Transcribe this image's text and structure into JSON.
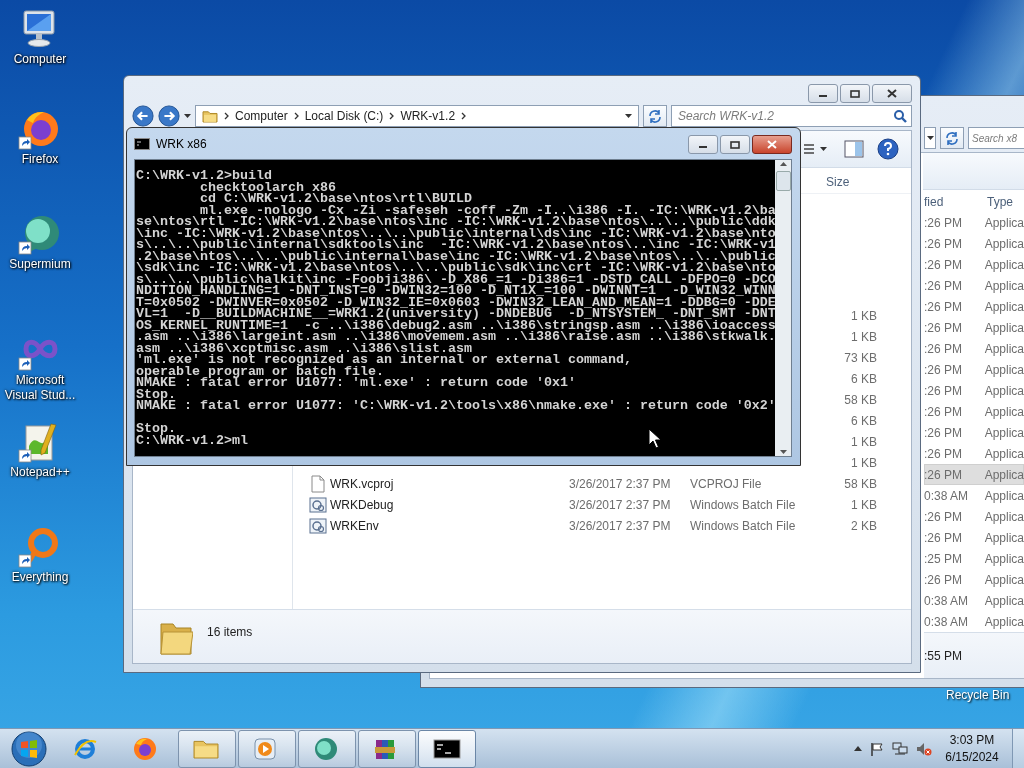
{
  "desktop": {
    "icons": [
      {
        "label": "Computer"
      },
      {
        "label": "Firefox"
      },
      {
        "label": "Supermium"
      },
      {
        "label": "Microsoft Visual Stud..."
      },
      {
        "label": "Notepad++"
      },
      {
        "label": "Everything"
      }
    ],
    "recycle_bin_label": "Recycle Bin"
  },
  "back_explorer": {
    "search": {
      "placeholder": "Search x8"
    },
    "columns": [
      "fied",
      "Type"
    ],
    "rows": [
      {
        "date": ":26 PM",
        "type": "Applica",
        "selected": false
      },
      {
        "date": ":26 PM",
        "type": "Applica",
        "selected": false
      },
      {
        "date": ":26 PM",
        "type": "Applica",
        "selected": false
      },
      {
        "date": ":26 PM",
        "type": "Applica",
        "selected": false
      },
      {
        "date": ":26 PM",
        "type": "Applica",
        "selected": false
      },
      {
        "date": ":26 PM",
        "type": "Applica",
        "selected": false
      },
      {
        "date": ":26 PM",
        "type": "Applica",
        "selected": false
      },
      {
        "date": ":26 PM",
        "type": "Applica",
        "selected": false
      },
      {
        "date": ":26 PM",
        "type": "Applica",
        "selected": false
      },
      {
        "date": ":26 PM",
        "type": "Applica",
        "selected": false
      },
      {
        "date": ":26 PM",
        "type": "Applica",
        "selected": false
      },
      {
        "date": ":26 PM",
        "type": "Applica",
        "selected": false
      },
      {
        "date": ":26 PM",
        "type": "Applica",
        "selected": true
      },
      {
        "date": "0:38 AM",
        "type": "Applica",
        "selected": false
      },
      {
        "date": ":26 PM",
        "type": "Applica",
        "selected": false
      },
      {
        "date": ":26 PM",
        "type": "Applica",
        "selected": false
      },
      {
        "date": ":25 PM",
        "type": "Applica",
        "selected": false
      },
      {
        "date": ":26 PM",
        "type": "Applica",
        "selected": false
      },
      {
        "date": "0:38 AM",
        "type": "Applica",
        "selected": false
      },
      {
        "date": "0:38 AM",
        "type": "Applica",
        "selected": false
      }
    ],
    "status": ":55 PM"
  },
  "explorer": {
    "address": {
      "crumbs": [
        "Computer",
        "Local Disk (C:)",
        "WRK-v1.2"
      ]
    },
    "search": {
      "placeholder": "Search WRK-v1.2"
    },
    "size_header": "Size",
    "rows": [
      {
        "size": "1 KB"
      },
      {
        "size": "1 KB"
      },
      {
        "size": "73 KB"
      },
      {
        "size": "6 KB"
      },
      {
        "size": "58 KB"
      },
      {
        "size": "6 KB"
      },
      {
        "size": "1 KB"
      },
      {
        "size": "1 KB"
      },
      {
        "kind": "file",
        "name": "WRK.vcproj",
        "date": "3/26/2017 2:37 PM",
        "type": "VCPROJ File",
        "size": "58 KB"
      },
      {
        "kind": "batch",
        "name": "WRKDebug",
        "date": "3/26/2017 2:37 PM",
        "type": "Windows Batch File",
        "size": "1 KB"
      },
      {
        "kind": "batch",
        "name": "WRKEnv",
        "date": "3/26/2017 2:37 PM",
        "type": "Windows Batch File",
        "size": "2 KB"
      }
    ],
    "status": "16 items"
  },
  "console": {
    "title": "WRK x86",
    "lines": [
      {
        "text": "C:\\WRK-v1.2>build"
      },
      {
        "text": "        checktoolarch x86"
      },
      {
        "text": "        cd C:\\WRK-v1.2\\base\\ntos\\rtl\\BUILD"
      },
      {
        "text": "        ml.exe -nologo -Cx -Zi -safeseh -coff -Zm -I..\\i386 -I. -IC:\\WRK-v1.2\\ba"
      },
      {
        "text": "se\\ntos\\rtl -IC:\\WRK-v1.2\\base\\ntos\\inc -IC:\\WRK-v1.2\\base\\ntos\\..\\..\\public\\ddk"
      },
      {
        "text": "\\inc -IC:\\WRK-v1.2\\base\\ntos\\..\\..\\public\\internal\\ds\\inc -IC:\\WRK-v1.2\\base\\nto"
      },
      {
        "text": "s\\..\\..\\public\\internal\\sdktools\\inc  -IC:\\WRK-v1.2\\base\\ntos\\..\\inc -IC:\\WRK-v1"
      },
      {
        "text": ".2\\base\\ntos\\..\\..\\public\\internal\\base\\inc -IC:\\WRK-v1.2\\base\\ntos\\..\\..\\public"
      },
      {
        "text": "\\sdk\\inc -IC:\\WRK-v1.2\\base\\ntos\\..\\..\\public\\sdk\\inc\\crt -IC:\\WRK-v1.2\\base\\nto"
      },
      {
        "text": "s\\..\\..\\public\\halkit\\inc -Foobji386\\ -D_X86_=1 -Di386=1 -DSTD_CALL -DFPO=0 -DCO"
      },
      {
        "text": "NDITION_HANDLING=1 -DNT_INST=0 -DWIN32=100 -D_NT1X_=100 -DWINNT=1  -D_WIN32_WINN"
      },
      {
        "text": "T=0x0502 -DWINVER=0x0502 -D_WIN32_IE=0x0603 -DWIN32_LEAN_AND_MEAN=1 -DDBG=0 -DDE"
      },
      {
        "text": "VL=1  -D__BUILDMACHINE__=WRK1.2(university) -DNDEBUG  -D_NTSYSTEM_ -DNT_SMT -DNT"
      },
      {
        "text": "OS_KERNEL_RUNTIME=1  -c ..\\i386\\debug2.asm ..\\i386\\stringsp.asm ..\\i386\\ioaccess"
      },
      {
        "text": ".asm ..\\i386\\largeint.asm ..\\i386\\movemem.asm ..\\i386\\raise.asm ..\\i386\\stkwalk."
      },
      {
        "text": "asm ..\\i386\\xcptmisc.asm ..\\i386\\slist.asm"
      },
      {
        "text": "'ml.exe' is not recognized as an internal or external command,"
      },
      {
        "text": "operable program or batch file."
      },
      {
        "text": "NMAKE : fatal error U1077: 'ml.exe' : return code '0x1'"
      },
      {
        "text": "Stop."
      },
      {
        "text": "NMAKE : fatal error U1077: 'C:\\WRK-v1.2\\tools\\x86\\nmake.exe' : return code '0x2'"
      },
      {
        "text": "Stop.",
        "gap_before": true
      },
      {
        "text": "C:\\WRK-v1.2>ml"
      }
    ]
  },
  "taskbar": {
    "items": [
      {
        "running": false,
        "active": false
      },
      {
        "running": false,
        "active": false
      },
      {
        "running": true,
        "active": false
      },
      {
        "running": true,
        "active": false
      },
      {
        "running": true,
        "active": false
      },
      {
        "running": true,
        "active": false
      },
      {
        "running": true,
        "active": true
      }
    ],
    "clock": {
      "time": "3:03 PM",
      "date": "6/15/2024"
    }
  }
}
